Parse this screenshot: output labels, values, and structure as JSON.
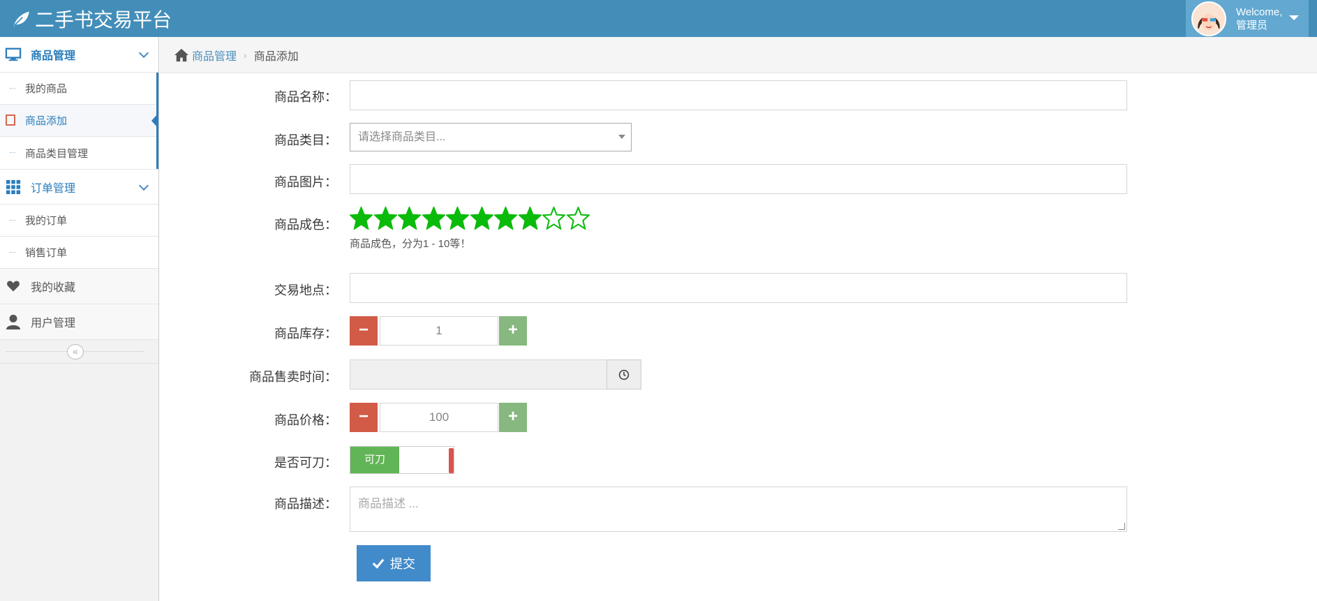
{
  "app": {
    "title": "二手书交易平台"
  },
  "user": {
    "welcome": "Welcome,",
    "name": "管理员"
  },
  "sidebar": {
    "groups": [
      {
        "label": "商品管理",
        "icon": "desktop-icon",
        "items": [
          "我的商品",
          "商品添加",
          "商品类目管理"
        ],
        "active_item": "商品添加"
      },
      {
        "label": "订单管理",
        "icon": "grid-icon",
        "items": [
          "我的订单",
          "销售订单"
        ]
      }
    ],
    "singles": [
      {
        "label": "我的收藏",
        "icon": "heart-icon"
      },
      {
        "label": "用户管理",
        "icon": "user-icon"
      }
    ],
    "collapse": "«"
  },
  "breadcrumb": {
    "parent": "商品管理",
    "current": "商品添加"
  },
  "form": {
    "name_label": "商品名称：",
    "category_label": "商品类目：",
    "category_placeholder": "请选择商品类目...",
    "image_label": "商品图片：",
    "condition_label": "商品成色：",
    "condition_rating": 8,
    "condition_max": 10,
    "condition_help": "商品成色，分为1 - 10等！",
    "location_label": "交易地点：",
    "stock_label": "商品库存：",
    "stock_value": "1",
    "sale_time_label": "商品售卖时间：",
    "price_label": "商品价格：",
    "price_value": "100",
    "bargain_label": "是否可刀：",
    "bargain_toggle": "可刀",
    "description_label": "商品描述：",
    "description_placeholder": "商品描述 ...",
    "submit_label": "提交"
  },
  "colors": {
    "navbar": "#438eb9",
    "accent": "#2b7dbc",
    "star": "#0bbb0b",
    "minus": "#d15b47",
    "plus": "#87b87f",
    "toggle_on": "#62b556",
    "submit": "#428bca"
  }
}
